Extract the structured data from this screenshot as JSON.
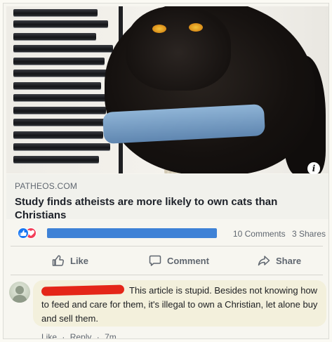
{
  "link_preview": {
    "domain": "PATHEOS.COM",
    "headline": "Study finds atheists are more likely to own cats than Christians",
    "info_badge": "i"
  },
  "engagement": {
    "comments_count": "10 Comments",
    "shares_count": "3 Shares"
  },
  "actions": {
    "like_label": "Like",
    "comment_label": "Comment",
    "share_label": "Share"
  },
  "comment": {
    "text": "This article is stupid. Besides not knowing how to feed and care for them, it's illegal to own a Christian, let alone buy and sell them.",
    "like_label": "Like",
    "separator": "·",
    "reply_label": "Reply",
    "time": "7m"
  },
  "colors": {
    "facebook_blue": "#1877f2",
    "love_red": "#f33e58",
    "redaction_red": "#e42618",
    "secondary_text": "#606770"
  }
}
